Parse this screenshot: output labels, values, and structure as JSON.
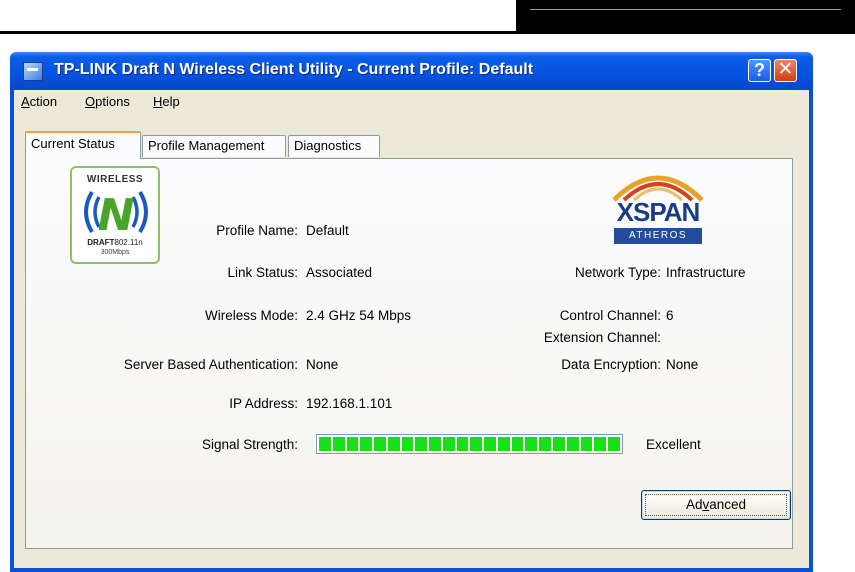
{
  "window": {
    "title": "TP-LINK Draft N Wireless Client Utility - Current Profile: Default",
    "help_glyph": "?",
    "close_glyph": "✕"
  },
  "menu": [
    {
      "label": "Action",
      "mnemonic": "A",
      "rest": "ction"
    },
    {
      "label": "Options",
      "mnemonic": "O",
      "rest": "ptions"
    },
    {
      "label": "Help",
      "mnemonic": "H",
      "rest": "elp"
    }
  ],
  "tabs": [
    {
      "label": "Current Status",
      "active": true
    },
    {
      "label": "Profile Management",
      "active": false
    },
    {
      "label": "Diagnostics",
      "active": false
    }
  ],
  "logos": {
    "wireless_n": {
      "top": "WIRELESS",
      "letter": "N",
      "draft": "DRAFT",
      "spec": "802.11n",
      "speed": "300Mbps"
    },
    "xspan": {
      "word": "XSPAN",
      "sub": "ATHEROS"
    }
  },
  "status": {
    "profile_name": {
      "label": "Profile Name:",
      "value": "Default"
    },
    "link_status": {
      "label": "Link Status:",
      "value": "Associated"
    },
    "wireless_mode": {
      "label": "Wireless Mode:",
      "value": "2.4 GHz 54 Mbps"
    },
    "server_auth": {
      "label": "Server Based Authentication:",
      "value": "None"
    },
    "ip_address": {
      "label": "IP Address:",
      "value": "192.168.1.101"
    },
    "network_type": {
      "label": "Network Type:",
      "value": "Infrastructure"
    },
    "control_channel": {
      "label": "Control Channel:",
      "value": "6"
    },
    "extension_channel": {
      "label": "Extension Channel:",
      "value": ""
    },
    "data_encryption": {
      "label": "Data Encryption:",
      "value": "None"
    },
    "signal_strength": {
      "label": "Signal Strength:",
      "value": "Excellent",
      "level": 1.0,
      "segments": 22
    }
  },
  "buttons": {
    "advanced": {
      "label": "Advanced",
      "before": "Ad",
      "mnemonic": "v",
      "after": "anced"
    }
  },
  "colors": {
    "signal_fill": "#18e018",
    "title_blue": "#0553e0",
    "tab_highlight": "#f7a33a"
  }
}
